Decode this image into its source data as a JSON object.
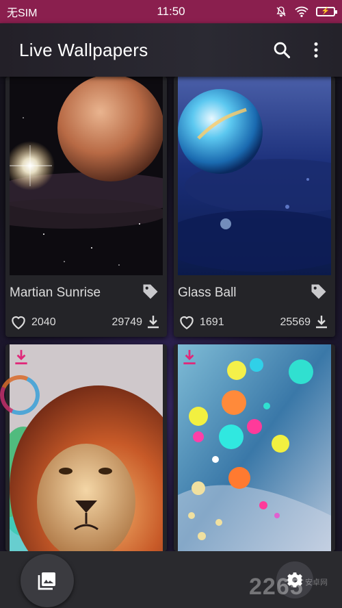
{
  "status_bar": {
    "carrier": "无SIM",
    "time": "11:50"
  },
  "app_bar": {
    "title": "Live Wallpapers",
    "search_icon": "search-icon",
    "menu_icon": "more-vert-icon"
  },
  "wallpapers": [
    {
      "title": "Martian Sunrise",
      "likes": "2040",
      "downloads": "29749"
    },
    {
      "title": "Glass Ball",
      "likes": "1691",
      "downloads": "25569"
    },
    {
      "title": "",
      "likes": "",
      "downloads": ""
    },
    {
      "title": "",
      "likes": "",
      "downloads": ""
    }
  ],
  "bottom_bar": {
    "gallery_icon": "photo-library-icon",
    "settings_icon": "settings-icon"
  },
  "watermark": {
    "text": "2265",
    "sub": "安卓网"
  },
  "colors": {
    "status_bar": "#8a1f4e",
    "accent": "#e0287a",
    "card": "#242428"
  }
}
